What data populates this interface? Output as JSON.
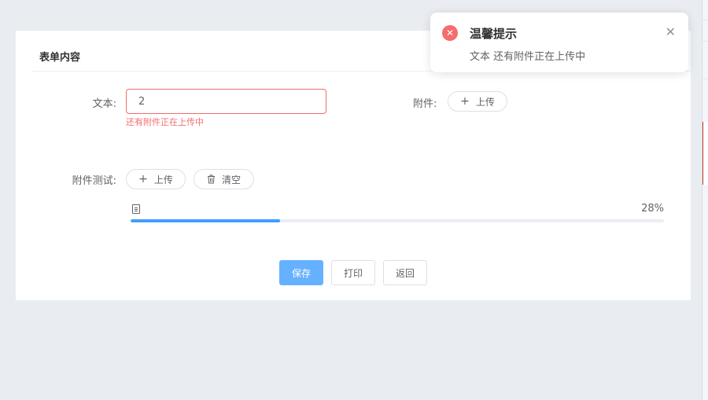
{
  "form": {
    "title": "表单内容",
    "text_label": "文本:",
    "text_value": "2",
    "text_error": "还有附件正在上传中",
    "attachment_label": "附件:",
    "upload_label": "上传",
    "attachment_test_label": "附件测试:",
    "clear_label": "清空",
    "progress": {
      "percent_text": "28%",
      "value": 28
    },
    "actions": {
      "save_label": "保存",
      "print_label": "打印",
      "back_label": "返回"
    }
  },
  "notification": {
    "title": "温馨提示",
    "message": "文本 还有附件正在上传中"
  },
  "colors": {
    "primary": "#66b1ff",
    "progress": "#409eff",
    "error": "#f56c6c"
  },
  "icons": {
    "upload": "plus-icon",
    "clear": "trash-icon",
    "file": "file-icon",
    "error": "error-circle-icon",
    "close": "close-icon"
  }
}
